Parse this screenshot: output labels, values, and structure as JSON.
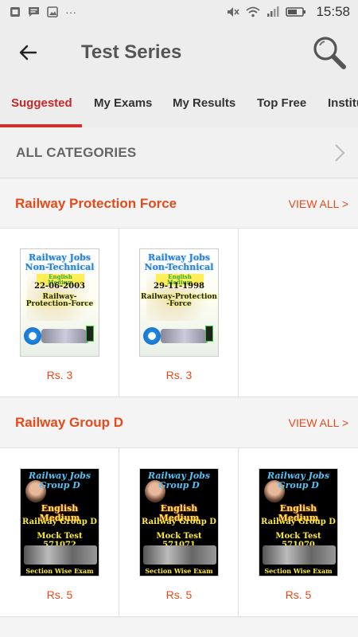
{
  "status_bar": {
    "time": "15:58",
    "left_icons": [
      "notification-icon",
      "message-icon",
      "gallery-icon"
    ],
    "more_glyph": "···",
    "battery_color": "#555555"
  },
  "app_bar": {
    "title": "Test Series"
  },
  "tabs": [
    {
      "label": "Suggested",
      "active": true
    },
    {
      "label": "My Exams",
      "active": false
    },
    {
      "label": "My Results",
      "active": false
    },
    {
      "label": "Top Free",
      "active": false
    },
    {
      "label": "Institu",
      "active": false
    }
  ],
  "all_categories": {
    "label": "ALL CATEGORIES"
  },
  "sections": [
    {
      "title": "Railway Protection Force",
      "view_all": "VIEW ALL >",
      "items": [
        {
          "price": "Rs. 3",
          "cover": {
            "line1": "Railway Jobs Non-Technical",
            "line2": "English Medium",
            "line3": "22-06-2003",
            "line4": "Railway-Protection-Force"
          }
        },
        {
          "price": "Rs. 3",
          "cover": {
            "line1": "Railway Jobs Non-Technical",
            "line2": "English Medium",
            "line3": "29-11-1998",
            "line4": "Railway-Protection -Force"
          }
        }
      ]
    },
    {
      "title": "Railway Group D",
      "view_all": "VIEW ALL >",
      "items": [
        {
          "price": "Rs. 5",
          "cover": {
            "line1": "Railway Jobs Group D",
            "line2": "English Medium",
            "line3": "Railway Group D",
            "line4": "Mock Test 571072",
            "line5": "Section Wise Exam"
          }
        },
        {
          "price": "Rs. 5",
          "cover": {
            "line1": "Railway Jobs Group D",
            "line2": "English Medium",
            "line3": "Railway Group D",
            "line4": "Mock Test 571071",
            "line5": "Section Wise Exam"
          }
        },
        {
          "price": "Rs. 5",
          "cover": {
            "line1": "Railway Jobs Group D",
            "line2": "English Medium",
            "line3": "Railway Group D",
            "line4": "Mock Test 571070",
            "line5": "Section Wise Exam"
          }
        }
      ]
    }
  ],
  "colors": {
    "accent": "#e64a19",
    "tab_active": "#c62828",
    "indicator": "#d32f2f",
    "app_bar_bg": "#ededed"
  }
}
